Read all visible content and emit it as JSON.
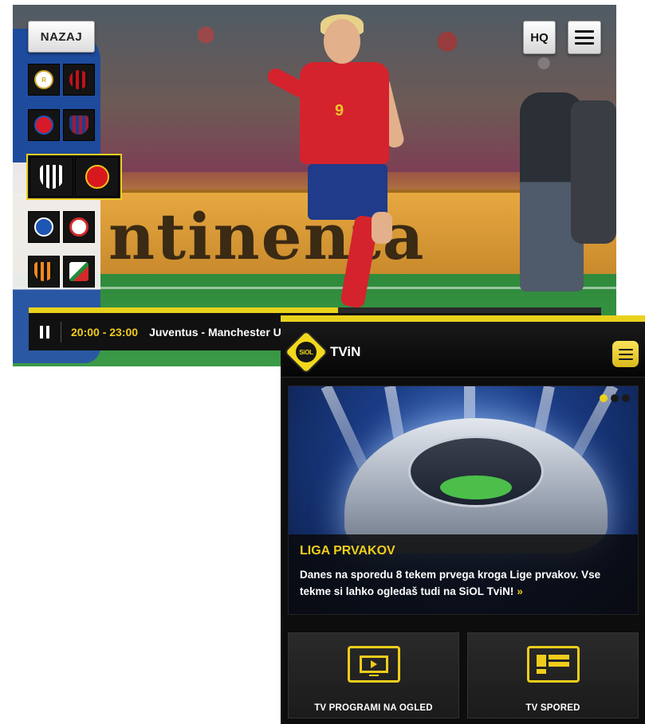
{
  "player": {
    "back_label": "NAZAJ",
    "hq_label": "HQ",
    "menu_icon": "hamburger-menu-icon",
    "adboard_text": "ntinenta",
    "shirt_number": "9",
    "matches": [
      {
        "home": "Real Madrid",
        "away": "AC Milan",
        "home_color": "#ffffff",
        "away_color": "#c0121c"
      },
      {
        "home": "Bayern München",
        "away": "FC Barcelona",
        "home_color": "#d7192a",
        "away_color": "#1f3d8a"
      },
      {
        "home": "Juventus",
        "away": "Manchester United",
        "home_color": "#ffffff",
        "away_color": "#d8181f",
        "active": true
      },
      {
        "home": "FC København",
        "away": "Olympiacos",
        "home_color": "#1e56b4",
        "away_color": "#d42a2a"
      },
      {
        "home": "Valencia",
        "away": "Legia Warszawa",
        "home_color": "#f08a1c",
        "away_color": "#1f8a3c"
      }
    ],
    "progress": 0.54,
    "time_range": "20:00 - 23:00",
    "now_playing": "Juventus - Manchester United",
    "colors": {
      "accent": "#e9d21c",
      "bar": "#111111"
    }
  },
  "phone": {
    "logo_text": "SiOL",
    "app_title": "TViN",
    "promo": {
      "title": "LIGA PRVAKOV",
      "text": "Danes na sporedu 8 tekem prvega kroga Lige prvakov. Vse tekme si lahko ogledaš tudi na SiOL TviN!",
      "arrows": "»",
      "slides": 3,
      "active_slide": 1
    },
    "tiles": [
      {
        "label": "TV PROGRAMI NA OGLED",
        "icon": "tv-play-icon"
      },
      {
        "label": "TV SPORED",
        "icon": "tv-guide-list-icon"
      }
    ],
    "colors": {
      "accent": "#f0cd1c",
      "background": "#0d0d0d"
    }
  }
}
